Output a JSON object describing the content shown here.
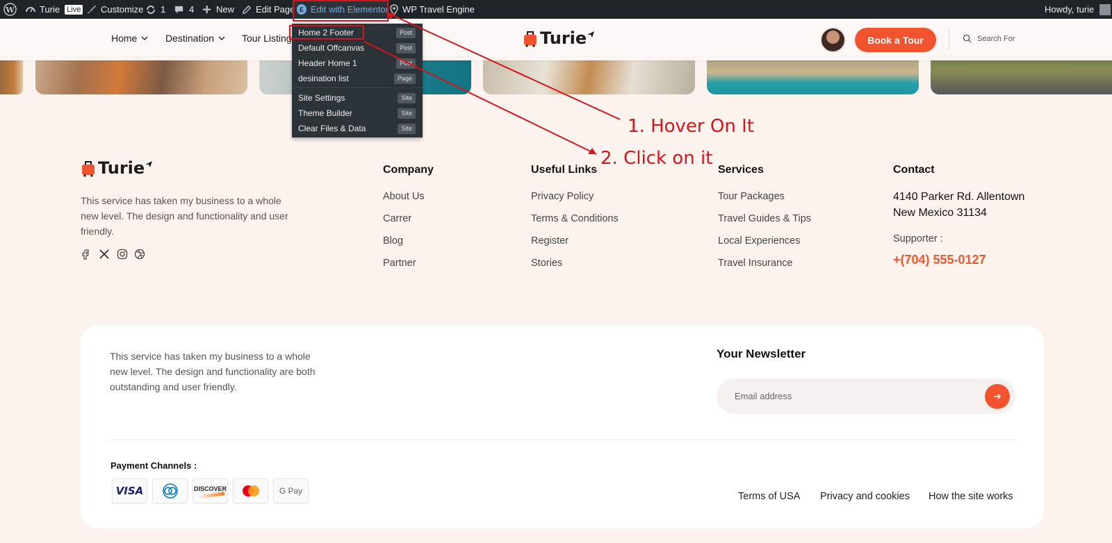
{
  "admin_bar": {
    "site_name": "Turie",
    "live_badge": "Live",
    "customize": "Customize",
    "updates_count": "1",
    "comments_count": "4",
    "new": "New",
    "edit_page": "Edit Page",
    "edit_with_elementor": "Edit with Elementor",
    "wp_travel_engine": "WP Travel Engine",
    "greeting": "Howdy, turie"
  },
  "elementor_menu": {
    "items": [
      {
        "label": "Home 2 Footer",
        "tag": "Post"
      },
      {
        "label": "Default Offcanvas",
        "tag": "Post"
      },
      {
        "label": "Header Home 1",
        "tag": "Post"
      },
      {
        "label": "desination list",
        "tag": "Page"
      },
      {
        "label": "Site Settings",
        "tag": "Site"
      },
      {
        "label": "Theme Builder",
        "tag": "Site"
      },
      {
        "label": "Clear Files & Data",
        "tag": "Site"
      }
    ]
  },
  "header": {
    "nav": [
      "Home",
      "Destination",
      "Tour Listing"
    ],
    "logo_text": "Turie",
    "book_button": "Book a Tour",
    "search_placeholder": "Search For"
  },
  "annotations": {
    "step1": "1. Hover On It",
    "step2": "2. Click on it",
    "color": "#d4151b"
  },
  "footer": {
    "logo_text": "Turie",
    "about": "This service has taken my business to a whole new level. The design and functionality and user friendly.",
    "social_icons": [
      "facebook-icon",
      "x-icon",
      "instagram-icon",
      "dribbble-icon"
    ],
    "company": {
      "title": "Company",
      "links": [
        "About Us",
        "Carrer",
        "Blog",
        "Partner"
      ]
    },
    "useful_links": {
      "title": "Useful Links",
      "links": [
        "Privacy Policy",
        "Terms & Conditions",
        "Register",
        "Stories"
      ]
    },
    "services": {
      "title": "Services",
      "links": [
        "Tour Packages",
        "Travel Guides & Tips",
        "Local Experiences",
        "Travel Insurance"
      ]
    },
    "contact": {
      "title": "Contact",
      "address_line1": "4140 Parker Rd. Allentown",
      "address_line2": "New Mexico 31134",
      "supporter_label": "Supporter :",
      "phone": "+(704) 555-0127"
    }
  },
  "bottom_card": {
    "about": "This service has taken my business to a whole new level. The design and functionality are both outstanding and user friendly.",
    "newsletter_title": "Your Newsletter",
    "email_placeholder": "Email address",
    "payment_title": "Payment Channels :",
    "payment_methods": [
      "VISA",
      "Diners Club",
      "DISCOVER",
      "Mastercard",
      "G Pay"
    ],
    "links": [
      "Terms of USA",
      "Privacy and cookies",
      "How the site works"
    ]
  },
  "colors": {
    "accent": "#f2532f",
    "background": "#fdf3ee",
    "admin_bar": "#1d2327",
    "elementor_blue": "#72aee6"
  }
}
